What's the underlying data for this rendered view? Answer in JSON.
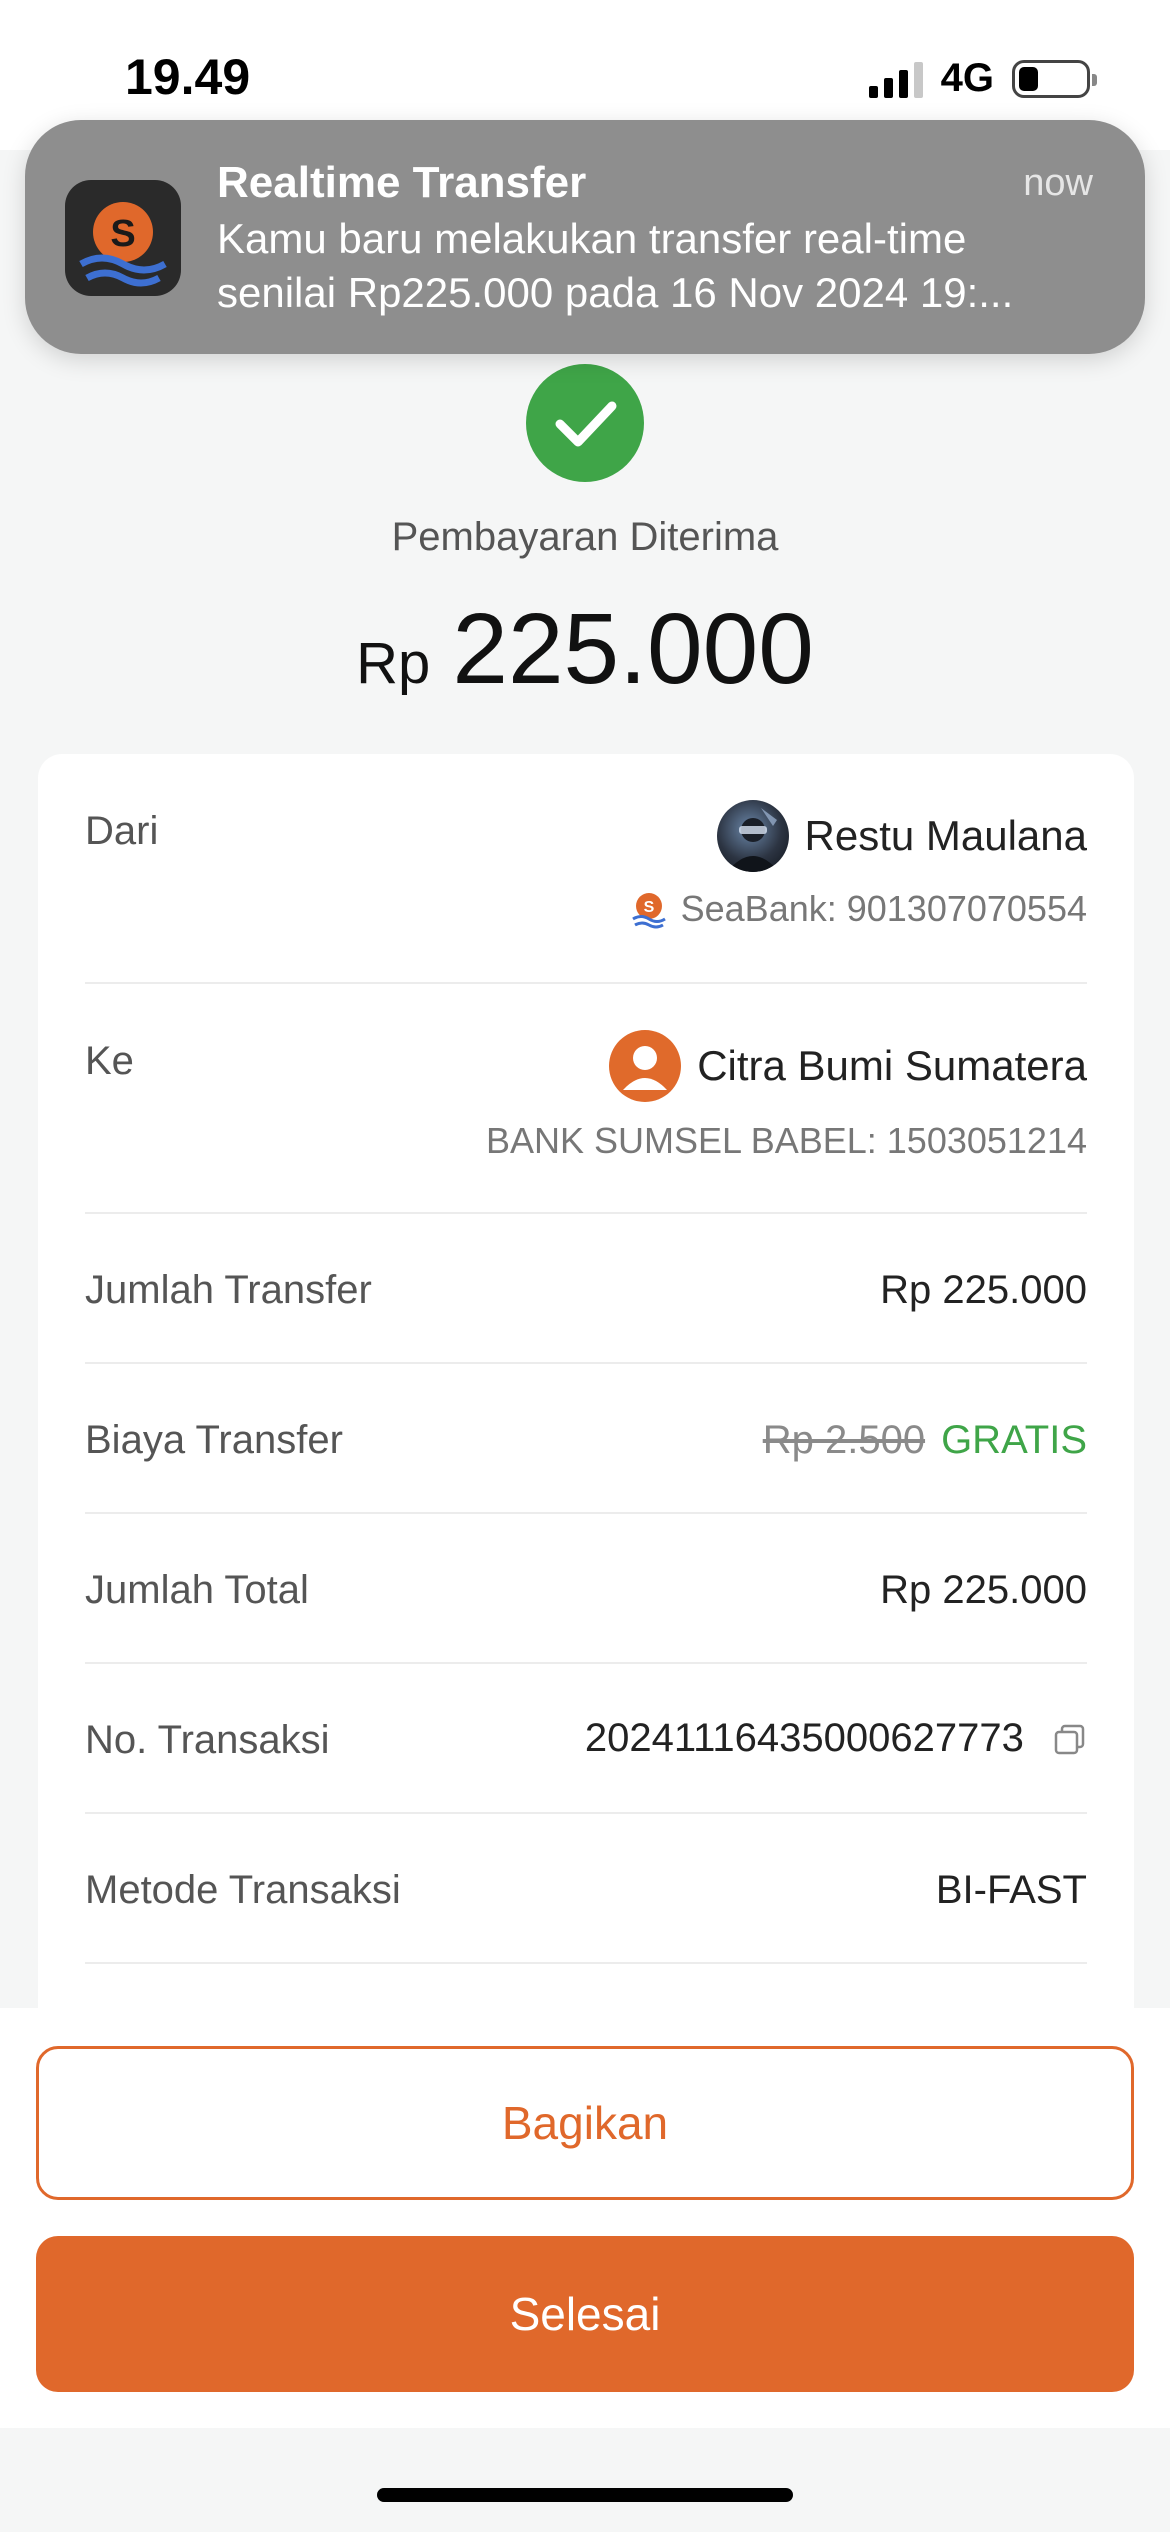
{
  "status_bar": {
    "time": "19.49",
    "network": "4G",
    "battery_level": 0.3
  },
  "notification": {
    "app_icon": "seabank-logo-icon",
    "title": "Realtime Transfer",
    "time": "now",
    "body_line1": "Kamu baru melakukan transfer real-time",
    "body_line2": "senilai Rp225.000 pada 16 Nov 2024 19:..."
  },
  "header": {
    "status_icon": "checkmark-icon",
    "status_label": "Pembayaran Diterima",
    "currency": "Rp",
    "amount": "225.000"
  },
  "details": {
    "from": {
      "label": "Dari",
      "name": "Restu Maulana",
      "account": "SeaBank: 901307070554",
      "avatar": "profile-photo"
    },
    "to": {
      "label": "Ke",
      "name": "Citra Bumi Sumatera",
      "account": "BANK SUMSEL BABEL: 1503051214",
      "avatar": "default-user-icon"
    },
    "transfer_amount": {
      "label": "Jumlah Transfer",
      "value": "Rp 225.000"
    },
    "transfer_fee": {
      "label": "Biaya Transfer",
      "original": "Rp 2.500",
      "value": "GRATIS"
    },
    "total_amount": {
      "label": "Jumlah Total",
      "value": "Rp 225.000"
    },
    "transaction_no": {
      "label": "No. Transaksi",
      "value": "20241116435000627773"
    },
    "method": {
      "label": "Metode Transaksi",
      "value": "BI-FAST"
    }
  },
  "actions": {
    "share_label": "Bagikan",
    "done_label": "Selesai"
  },
  "colors": {
    "accent": "#e0682b",
    "success": "#3fa548",
    "background": "#f5f6f6"
  }
}
